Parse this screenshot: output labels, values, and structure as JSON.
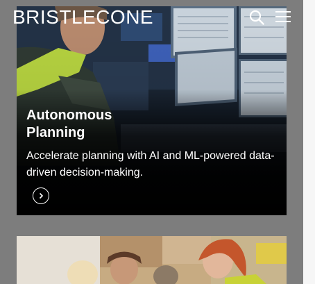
{
  "header": {
    "logo_text": "BRISTLECONE",
    "search_icon": "search-icon",
    "menu_icon": "hamburger-menu-icon"
  },
  "cards": [
    {
      "title": "Autonomous\nPlanning",
      "description": "Accelerate planning with AI and ML-powered data-driven decision-making.",
      "action_icon": "chevron-right-circle-icon"
    },
    {
      "title": "",
      "description": ""
    }
  ],
  "colors": {
    "page_background": "#7d7d7d",
    "text": "#ffffff",
    "card_overlay": "#000000"
  }
}
